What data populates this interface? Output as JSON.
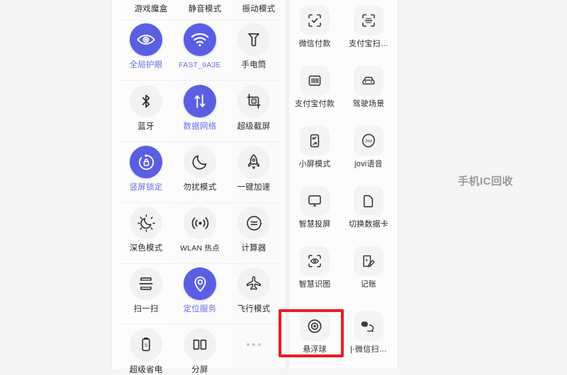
{
  "background_color": "#f5f5f5",
  "accent_color": "#5a5fe2",
  "accent_label_color": "#6b6fe6",
  "highlight_color": "#ed1b24",
  "watermark": {
    "text": "手机IC回收"
  },
  "left_panel": {
    "name": "control-center-shortcuts-panel",
    "top_row_labels": [
      {
        "label": "游戏魔盒",
        "icon": "game-box-icon"
      },
      {
        "label": "静音模式",
        "icon": "mute-icon"
      },
      {
        "label": "振动模式",
        "icon": "vibrate-icon"
      }
    ],
    "tiles": [
      {
        "label": "全局护眼",
        "icon": "eye-care-icon",
        "active": true
      },
      {
        "label": "FAST_9A3E",
        "icon": "wifi-icon",
        "active": true
      },
      {
        "label": "手电筒",
        "icon": "flashlight-icon",
        "active": false
      },
      {
        "label": "蓝牙",
        "icon": "bluetooth-icon",
        "active": false
      },
      {
        "label": "数据网络",
        "icon": "data-network-icon",
        "active": true
      },
      {
        "label": "超级截屏",
        "icon": "super-screenshot-icon",
        "active": false
      },
      {
        "label": "竖屏锁定",
        "icon": "rotation-lock-icon",
        "active": true
      },
      {
        "label": "勿扰模式",
        "icon": "do-not-disturb-moon-icon",
        "active": false
      },
      {
        "label": "一键加速",
        "icon": "rocket-boost-icon",
        "active": false
      },
      {
        "label": "深色模式",
        "icon": "dark-mode-icon",
        "active": false
      },
      {
        "label": "WLAN 热点",
        "icon": "hotspot-icon",
        "active": false
      },
      {
        "label": "计算器",
        "icon": "calculator-icon",
        "active": false
      },
      {
        "label": "扫一扫",
        "icon": "scan-icon",
        "active": false
      },
      {
        "label": "定位服务",
        "icon": "location-pin-icon",
        "active": true
      },
      {
        "label": "飞行模式",
        "icon": "airplane-icon",
        "active": false
      },
      {
        "label": "超级省电",
        "icon": "super-battery-saver-icon",
        "active": false
      },
      {
        "label": "分屏",
        "icon": "split-screen-icon",
        "active": false
      },
      {
        "label": "",
        "icon": "more-dots-icon",
        "active": false
      }
    ]
  },
  "right_panel": {
    "name": "quick-actions-panel",
    "tiles": [
      {
        "label": "微信付款",
        "icon": "wechat-pay-scan-icon"
      },
      {
        "label": "支付宝扫…",
        "icon": "alipay-scan-icon"
      },
      {
        "label": "支付宝付款",
        "icon": "alipay-barcode-icon"
      },
      {
        "label": "驾驶场景",
        "icon": "driving-mode-car-icon"
      },
      {
        "label": "小屏模式",
        "icon": "small-screen-icon"
      },
      {
        "label": "jovi语音",
        "icon": "jovi-voice-icon"
      },
      {
        "label": "智慧投屏",
        "icon": "smart-cast-icon"
      },
      {
        "label": "切换数据卡",
        "icon": "switch-sim-card-icon"
      },
      {
        "label": "智慧识图",
        "icon": "smart-image-recognition-icon"
      },
      {
        "label": "记账",
        "icon": "bookkeeping-icon"
      },
      {
        "label": "悬浮球",
        "icon": "floating-ball-icon",
        "highlighted": true
      },
      {
        "label": "|·微信扫…",
        "icon": "wechat-scan-shortcut-icon"
      }
    ]
  }
}
